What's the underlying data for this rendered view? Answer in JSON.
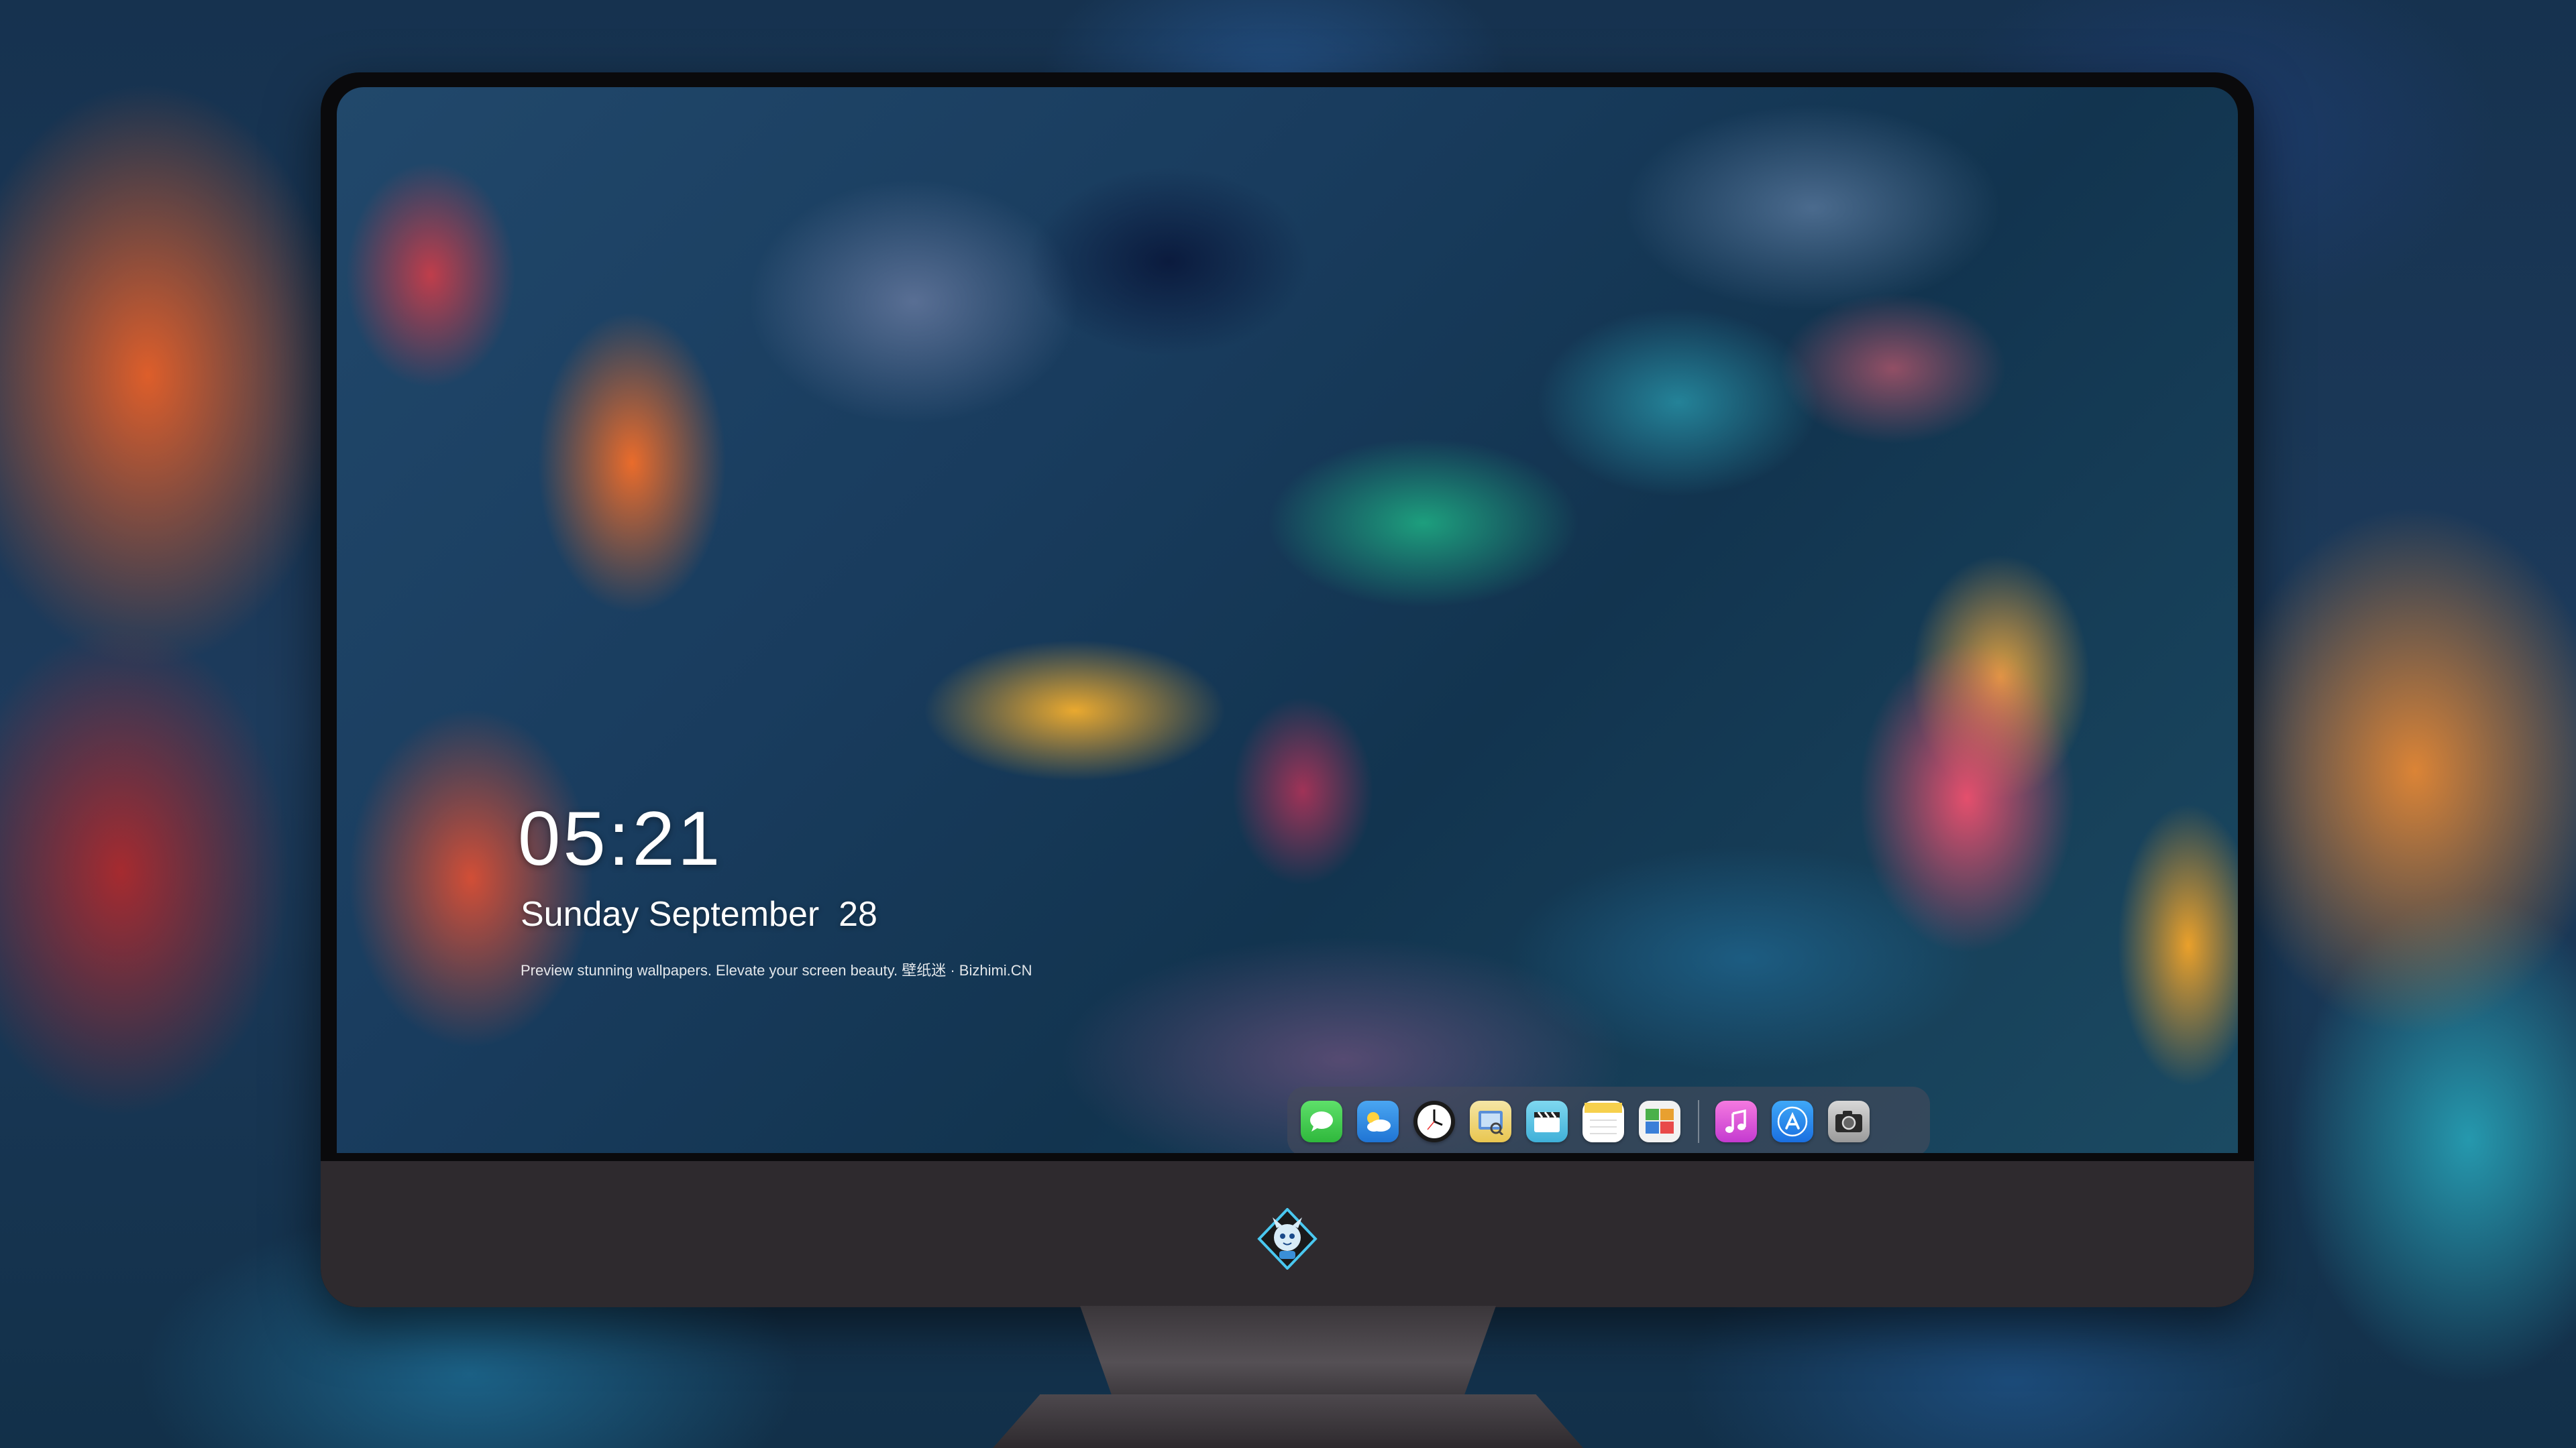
{
  "lockscreen": {
    "time": "05:21",
    "date": "Sunday September  28",
    "tagline": "Preview stunning wallpapers. Elevate your screen beauty. 壁纸迷 · Bizhimi.CN"
  },
  "dock": {
    "apps": [
      {
        "name": "messages-icon",
        "color": "#3fcf4a"
      },
      {
        "name": "weather-icon",
        "color": "#2b8fe8"
      },
      {
        "name": "clock-icon",
        "color": "#ffffff"
      },
      {
        "name": "preview-icon",
        "color": "#f0c640"
      },
      {
        "name": "clips-icon",
        "color": "#5ec8e8"
      },
      {
        "name": "notes-icon",
        "color": "#f6d04d"
      },
      {
        "name": "photo-gallery-icon",
        "color": "#e8e8e8"
      },
      {
        "name": "music-icon",
        "color": "#e84ad6"
      },
      {
        "name": "app-store-icon",
        "color": "#2a8cf0"
      },
      {
        "name": "camera-icon",
        "color": "#cfcfcf"
      }
    ]
  },
  "colors": {
    "bezel": "#0a0a0c",
    "chin": "#2e2a2e",
    "dock_bg": "#464b5a"
  }
}
